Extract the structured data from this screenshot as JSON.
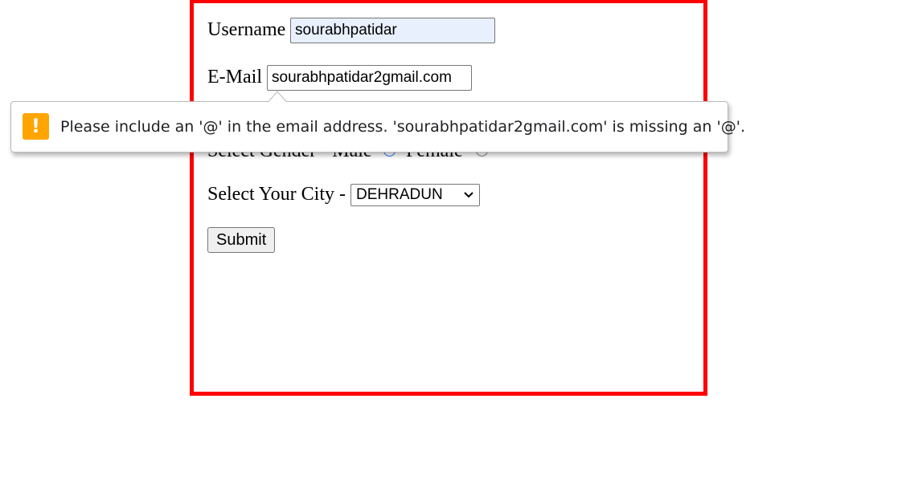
{
  "form": {
    "username_label": "Username",
    "username_value": "sourabhpatidar",
    "email_label": "E-Mail",
    "email_value": "sourabhpatidar2gmail.com",
    "gender_label": "Select Gender - Male",
    "gender_female_label": "Female",
    "city_label": "Select Your City -",
    "city_selected": "DEHRADUN",
    "submit_label": "Submit"
  },
  "validation_bubble": {
    "icon": "warning-icon",
    "message": "Please include an '@' in the email address. 'sourabhpatidar2gmail.com' is missing an '@'.",
    "icon_color": "#ffa500"
  },
  "colors": {
    "form_border": "#ff0000",
    "autofill_background": "#e8f0fe"
  }
}
